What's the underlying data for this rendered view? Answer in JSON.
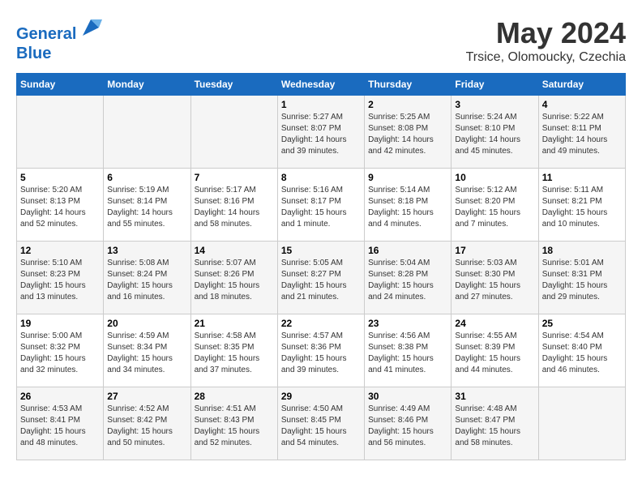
{
  "logo": {
    "line1": "General",
    "line2": "Blue"
  },
  "title": "May 2024",
  "subtitle": "Trsice, Olomoucky, Czechia",
  "days_header": [
    "Sunday",
    "Monday",
    "Tuesday",
    "Wednesday",
    "Thursday",
    "Friday",
    "Saturday"
  ],
  "weeks": [
    [
      {
        "num": "",
        "sunrise": "",
        "sunset": "",
        "daylight": ""
      },
      {
        "num": "",
        "sunrise": "",
        "sunset": "",
        "daylight": ""
      },
      {
        "num": "",
        "sunrise": "",
        "sunset": "",
        "daylight": ""
      },
      {
        "num": "1",
        "sunrise": "Sunrise: 5:27 AM",
        "sunset": "Sunset: 8:07 PM",
        "daylight": "Daylight: 14 hours and 39 minutes."
      },
      {
        "num": "2",
        "sunrise": "Sunrise: 5:25 AM",
        "sunset": "Sunset: 8:08 PM",
        "daylight": "Daylight: 14 hours and 42 minutes."
      },
      {
        "num": "3",
        "sunrise": "Sunrise: 5:24 AM",
        "sunset": "Sunset: 8:10 PM",
        "daylight": "Daylight: 14 hours and 45 minutes."
      },
      {
        "num": "4",
        "sunrise": "Sunrise: 5:22 AM",
        "sunset": "Sunset: 8:11 PM",
        "daylight": "Daylight: 14 hours and 49 minutes."
      }
    ],
    [
      {
        "num": "5",
        "sunrise": "Sunrise: 5:20 AM",
        "sunset": "Sunset: 8:13 PM",
        "daylight": "Daylight: 14 hours and 52 minutes."
      },
      {
        "num": "6",
        "sunrise": "Sunrise: 5:19 AM",
        "sunset": "Sunset: 8:14 PM",
        "daylight": "Daylight: 14 hours and 55 minutes."
      },
      {
        "num": "7",
        "sunrise": "Sunrise: 5:17 AM",
        "sunset": "Sunset: 8:16 PM",
        "daylight": "Daylight: 14 hours and 58 minutes."
      },
      {
        "num": "8",
        "sunrise": "Sunrise: 5:16 AM",
        "sunset": "Sunset: 8:17 PM",
        "daylight": "Daylight: 15 hours and 1 minute."
      },
      {
        "num": "9",
        "sunrise": "Sunrise: 5:14 AM",
        "sunset": "Sunset: 8:18 PM",
        "daylight": "Daylight: 15 hours and 4 minutes."
      },
      {
        "num": "10",
        "sunrise": "Sunrise: 5:12 AM",
        "sunset": "Sunset: 8:20 PM",
        "daylight": "Daylight: 15 hours and 7 minutes."
      },
      {
        "num": "11",
        "sunrise": "Sunrise: 5:11 AM",
        "sunset": "Sunset: 8:21 PM",
        "daylight": "Daylight: 15 hours and 10 minutes."
      }
    ],
    [
      {
        "num": "12",
        "sunrise": "Sunrise: 5:10 AM",
        "sunset": "Sunset: 8:23 PM",
        "daylight": "Daylight: 15 hours and 13 minutes."
      },
      {
        "num": "13",
        "sunrise": "Sunrise: 5:08 AM",
        "sunset": "Sunset: 8:24 PM",
        "daylight": "Daylight: 15 hours and 16 minutes."
      },
      {
        "num": "14",
        "sunrise": "Sunrise: 5:07 AM",
        "sunset": "Sunset: 8:26 PM",
        "daylight": "Daylight: 15 hours and 18 minutes."
      },
      {
        "num": "15",
        "sunrise": "Sunrise: 5:05 AM",
        "sunset": "Sunset: 8:27 PM",
        "daylight": "Daylight: 15 hours and 21 minutes."
      },
      {
        "num": "16",
        "sunrise": "Sunrise: 5:04 AM",
        "sunset": "Sunset: 8:28 PM",
        "daylight": "Daylight: 15 hours and 24 minutes."
      },
      {
        "num": "17",
        "sunrise": "Sunrise: 5:03 AM",
        "sunset": "Sunset: 8:30 PM",
        "daylight": "Daylight: 15 hours and 27 minutes."
      },
      {
        "num": "18",
        "sunrise": "Sunrise: 5:01 AM",
        "sunset": "Sunset: 8:31 PM",
        "daylight": "Daylight: 15 hours and 29 minutes."
      }
    ],
    [
      {
        "num": "19",
        "sunrise": "Sunrise: 5:00 AM",
        "sunset": "Sunset: 8:32 PM",
        "daylight": "Daylight: 15 hours and 32 minutes."
      },
      {
        "num": "20",
        "sunrise": "Sunrise: 4:59 AM",
        "sunset": "Sunset: 8:34 PM",
        "daylight": "Daylight: 15 hours and 34 minutes."
      },
      {
        "num": "21",
        "sunrise": "Sunrise: 4:58 AM",
        "sunset": "Sunset: 8:35 PM",
        "daylight": "Daylight: 15 hours and 37 minutes."
      },
      {
        "num": "22",
        "sunrise": "Sunrise: 4:57 AM",
        "sunset": "Sunset: 8:36 PM",
        "daylight": "Daylight: 15 hours and 39 minutes."
      },
      {
        "num": "23",
        "sunrise": "Sunrise: 4:56 AM",
        "sunset": "Sunset: 8:38 PM",
        "daylight": "Daylight: 15 hours and 41 minutes."
      },
      {
        "num": "24",
        "sunrise": "Sunrise: 4:55 AM",
        "sunset": "Sunset: 8:39 PM",
        "daylight": "Daylight: 15 hours and 44 minutes."
      },
      {
        "num": "25",
        "sunrise": "Sunrise: 4:54 AM",
        "sunset": "Sunset: 8:40 PM",
        "daylight": "Daylight: 15 hours and 46 minutes."
      }
    ],
    [
      {
        "num": "26",
        "sunrise": "Sunrise: 4:53 AM",
        "sunset": "Sunset: 8:41 PM",
        "daylight": "Daylight: 15 hours and 48 minutes."
      },
      {
        "num": "27",
        "sunrise": "Sunrise: 4:52 AM",
        "sunset": "Sunset: 8:42 PM",
        "daylight": "Daylight: 15 hours and 50 minutes."
      },
      {
        "num": "28",
        "sunrise": "Sunrise: 4:51 AM",
        "sunset": "Sunset: 8:43 PM",
        "daylight": "Daylight: 15 hours and 52 minutes."
      },
      {
        "num": "29",
        "sunrise": "Sunrise: 4:50 AM",
        "sunset": "Sunset: 8:45 PM",
        "daylight": "Daylight: 15 hours and 54 minutes."
      },
      {
        "num": "30",
        "sunrise": "Sunrise: 4:49 AM",
        "sunset": "Sunset: 8:46 PM",
        "daylight": "Daylight: 15 hours and 56 minutes."
      },
      {
        "num": "31",
        "sunrise": "Sunrise: 4:48 AM",
        "sunset": "Sunset: 8:47 PM",
        "daylight": "Daylight: 15 hours and 58 minutes."
      },
      {
        "num": "",
        "sunrise": "",
        "sunset": "",
        "daylight": ""
      }
    ]
  ]
}
